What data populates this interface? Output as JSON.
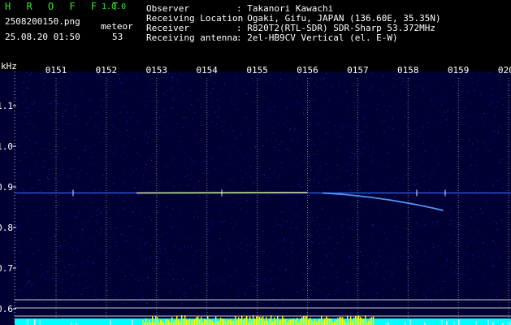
{
  "header": {
    "app_name": "H R O F F T",
    "version": "1.0.0",
    "file_name": "2508200150.png",
    "timestamp": "25.08.20 01:50",
    "meteor_label": "meteor",
    "meteor_count": "53",
    "info_rows": [
      {
        "label": "Observer",
        "value": ": Takanori Kawachi"
      },
      {
        "label": "Receiving Location",
        "value": ": Ogaki, Gifu, JAPAN (136.60E, 35.35N)"
      },
      {
        "label": "Receiver",
        "value": ": R820T2(RTL-SDR) SDR-Sharp 53.372MHz"
      },
      {
        "label": "Receiving antenna",
        "value": ": 2el-HB9CV Vertical (el. E-W)"
      }
    ]
  },
  "chart_data": {
    "type": "heatmap",
    "ylabel": "kHz",
    "x_ticks": [
      "0151",
      "0152",
      "0153",
      "0154",
      "0155",
      "0156",
      "0157",
      "0158",
      "0159",
      "0200"
    ],
    "y_ticks": [
      "1.1",
      "1.0",
      "0.9",
      "0.8",
      "0.7",
      "0.6"
    ],
    "ylim": [
      0.58,
      1.18
    ],
    "carrier_khz": 0.885,
    "meteor_echo": {
      "start_time": "0156.3",
      "end_time": "0158.7",
      "start_khz": 0.885,
      "end_khz": 0.842
    },
    "colors": {
      "background": "#000033",
      "signal": "#ffffaa",
      "echo": "#5a9cff",
      "level_bars": "#ffff00",
      "level_base": "#00ffff"
    }
  }
}
